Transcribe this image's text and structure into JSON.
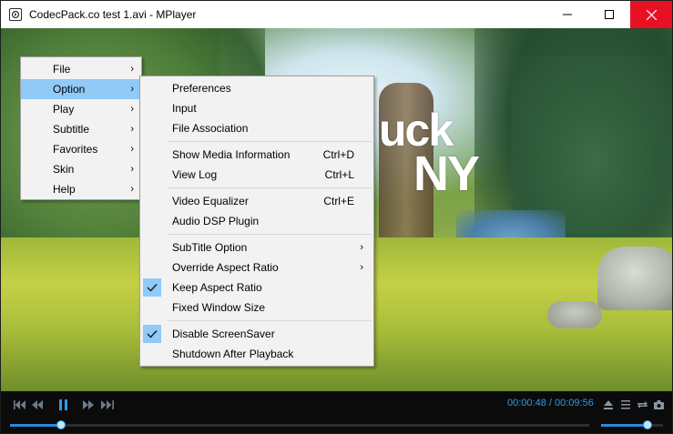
{
  "window": {
    "title": "CodecPack.co test 1.avi - MPlayer",
    "close_color": "#e81123"
  },
  "video_overlay": {
    "line1": "uck",
    "line2": "NY"
  },
  "main_menu": {
    "items": [
      {
        "label": "File",
        "has_submenu": true
      },
      {
        "label": "Option",
        "has_submenu": true,
        "highlighted": true
      },
      {
        "label": "Play",
        "has_submenu": true
      },
      {
        "label": "Subtitle",
        "has_submenu": true
      },
      {
        "label": "Favorites",
        "has_submenu": true
      },
      {
        "label": "Skin",
        "has_submenu": true
      },
      {
        "label": "Help",
        "has_submenu": true
      }
    ]
  },
  "option_menu": {
    "group1": [
      {
        "label": "Preferences"
      },
      {
        "label": "Input"
      },
      {
        "label": "File Association"
      }
    ],
    "group2": [
      {
        "label": "Show Media Information",
        "shortcut": "Ctrl+D"
      },
      {
        "label": "View Log",
        "shortcut": "Ctrl+L"
      }
    ],
    "group3": [
      {
        "label": "Video Equalizer",
        "shortcut": "Ctrl+E"
      },
      {
        "label": "Audio DSP Plugin"
      }
    ],
    "group4": [
      {
        "label": "SubTitle Option",
        "has_submenu": true
      },
      {
        "label": "Override Aspect Ratio",
        "has_submenu": true
      },
      {
        "label": "Keep Aspect Ratio",
        "checked": true
      },
      {
        "label": "Fixed Window Size"
      }
    ],
    "group5": [
      {
        "label": "Disable ScreenSaver",
        "checked": true
      },
      {
        "label": "Shutdown After Playback"
      }
    ]
  },
  "controls": {
    "time_display": "00:00:48 / 00:09:56",
    "seek_progress": 0.088,
    "volume_level": 0.75,
    "accent_color": "#2b8ad8"
  }
}
